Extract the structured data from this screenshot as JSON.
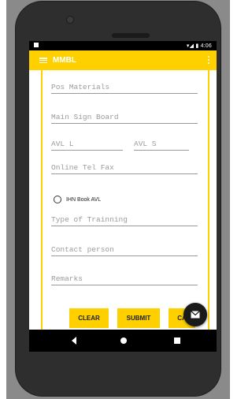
{
  "app": {
    "title": "MMBL",
    "status_time": "4:06"
  },
  "form": {
    "fields": [
      {
        "name": "pos-materials",
        "placeholder": "Pos Materials"
      },
      {
        "name": "main-sign-board",
        "placeholder": "Main Sign Board"
      },
      {
        "name": "avl-l",
        "placeholder": "AVL  L"
      },
      {
        "name": "avl-s",
        "placeholder": "AVL  S"
      },
      {
        "name": "online-tel-fax",
        "placeholder": "Online Tel Fax"
      },
      {
        "name": "type-of-training",
        "placeholder": "Type of Trainning"
      },
      {
        "name": "contact-person",
        "placeholder": "Contact person"
      },
      {
        "name": "remarks",
        "placeholder": "Remarks"
      }
    ],
    "radio": {
      "label": "IHN Book AVL",
      "selected": false
    }
  },
  "buttons": {
    "clear": "CLEAR",
    "submit": "SUBMIT",
    "cancel": "CA"
  },
  "colors": {
    "accent": "#ffd000",
    "statusbar": "#000000"
  }
}
